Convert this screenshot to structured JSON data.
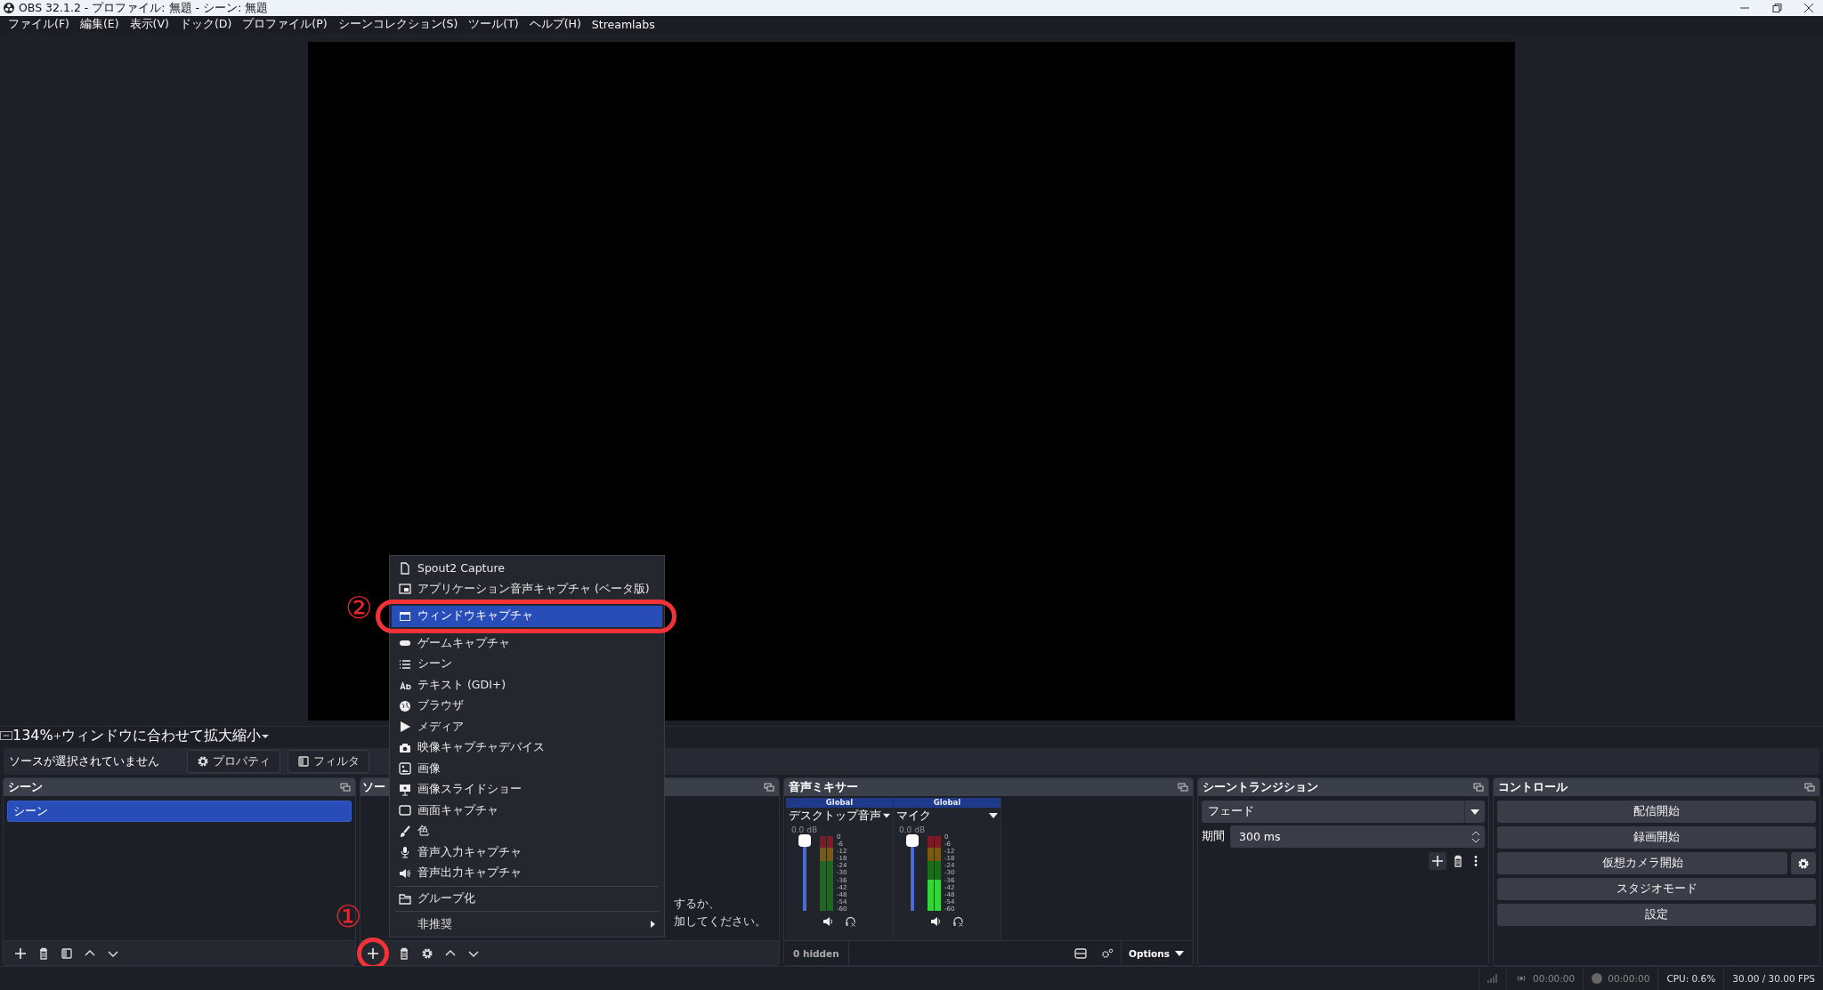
{
  "window": {
    "title": "OBS 32.1.2 - プロファイル: 無題 - シーン: 無題"
  },
  "menu_bar": [
    "ファイル(F)",
    "編集(E)",
    "表示(V)",
    "ドック(D)",
    "プロファイル(P)",
    "シーンコレクション(S)",
    "ツール(T)",
    "ヘルプ(H)",
    "Streamlabs"
  ],
  "preview_toolbar": {
    "zoom": "134%",
    "fit_label": "ウィンドウに合わせて拡大縮小"
  },
  "source_bar": {
    "status": "ソースが選択されていません",
    "buttons": [
      "プロパティ",
      "フィルタ"
    ]
  },
  "scenes_dock": {
    "title": "シーン",
    "items": [
      {
        "label": "シーン",
        "selected": true
      }
    ]
  },
  "sources_dock": {
    "title": "ソー",
    "hint_lines": [
      "するか、",
      "加してください。"
    ]
  },
  "audio_mixer": {
    "title": "音声ミキサー",
    "channels": [
      {
        "badge": "Global",
        "name": "デスクトップ音声",
        "reading": "0.0 dB",
        "level": 1,
        "active": false,
        "scale": [
          "0",
          "-6",
          "-12",
          "-18",
          "-24",
          "-30",
          "-36",
          "-42",
          "-48",
          "-54",
          "-60"
        ]
      },
      {
        "badge": "Global",
        "name": "マイク",
        "reading": "0.0 dB",
        "level": 1,
        "active": true,
        "scale": [
          "0",
          "-6",
          "-12",
          "-18",
          "-24",
          "-30",
          "-36",
          "-42",
          "-48",
          "-54",
          "-60"
        ]
      }
    ],
    "hidden_count": "0 hidden",
    "options": "Options"
  },
  "scene_transitions": {
    "title": "シーントランジション",
    "transition": "フェード",
    "duration_label": "期間",
    "duration": "300 ms"
  },
  "controls": {
    "title": "コントロール",
    "buttons": [
      "配信開始",
      "録画開始",
      "仮想カメラ開始",
      "スタジオモード",
      "設定"
    ]
  },
  "status_bar": {
    "stream_time": "00:00:00",
    "record_time": "00:00:00",
    "cpu": "CPU: 0.6%",
    "fps": "30.00 / 30.00 FPS"
  },
  "context_menu": {
    "groups": [
      {
        "items": [
          {
            "kind": "item",
            "label": "Spout2 Capture",
            "selected": false
          },
          {
            "kind": "item",
            "label": "アプリケーション音声キャプチャ (ベータ版)",
            "selected": false
          },
          {
            "kind": "item",
            "label": "ウィンドウキャプチャ",
            "selected": true
          },
          {
            "kind": "item",
            "label": "ゲームキャプチャ",
            "selected": false
          },
          {
            "kind": "item",
            "label": "シーン",
            "selected": false
          },
          {
            "kind": "item",
            "label": "テキスト (GDI+)",
            "selected": false
          },
          {
            "kind": "item",
            "label": "ブラウザ",
            "selected": false
          },
          {
            "kind": "item",
            "label": "メディア",
            "selected": false
          },
          {
            "kind": "item",
            "label": "映像キャプチャデバイス",
            "selected": false
          },
          {
            "kind": "item",
            "label": "画像",
            "selected": false
          },
          {
            "kind": "item",
            "label": "画像スライドショー",
            "selected": false
          },
          {
            "kind": "item",
            "label": "画面キャプチャ",
            "selected": false
          },
          {
            "kind": "item",
            "label": "色",
            "selected": false
          },
          {
            "kind": "item",
            "label": "音声入力キャプチャ",
            "selected": false
          },
          {
            "kind": "item",
            "label": "音声出力キャプチャ",
            "selected": false
          }
        ]
      },
      {
        "items": [
          {
            "kind": "item",
            "label": "グループ化",
            "selected": false
          }
        ]
      },
      {
        "items": [
          {
            "kind": "submenu",
            "label": "非推奨",
            "selected": false
          }
        ]
      }
    ]
  },
  "annotations": [
    {
      "label": "②"
    },
    {
      "label": "①"
    }
  ]
}
